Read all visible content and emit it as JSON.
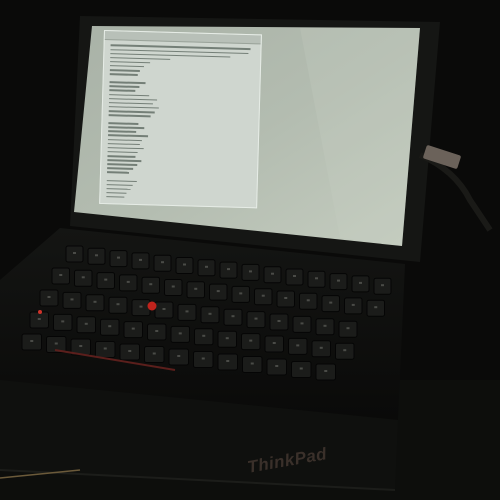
{
  "brand": {
    "logo_text": "ThinkPad"
  },
  "colors": {
    "screen_glow": "#b7c0b5",
    "window_bg": "#cfd6cf",
    "trackpoint": "#c0231c",
    "led_red": "#d0332a"
  },
  "screen": {
    "window": {
      "line_count": 38
    }
  }
}
